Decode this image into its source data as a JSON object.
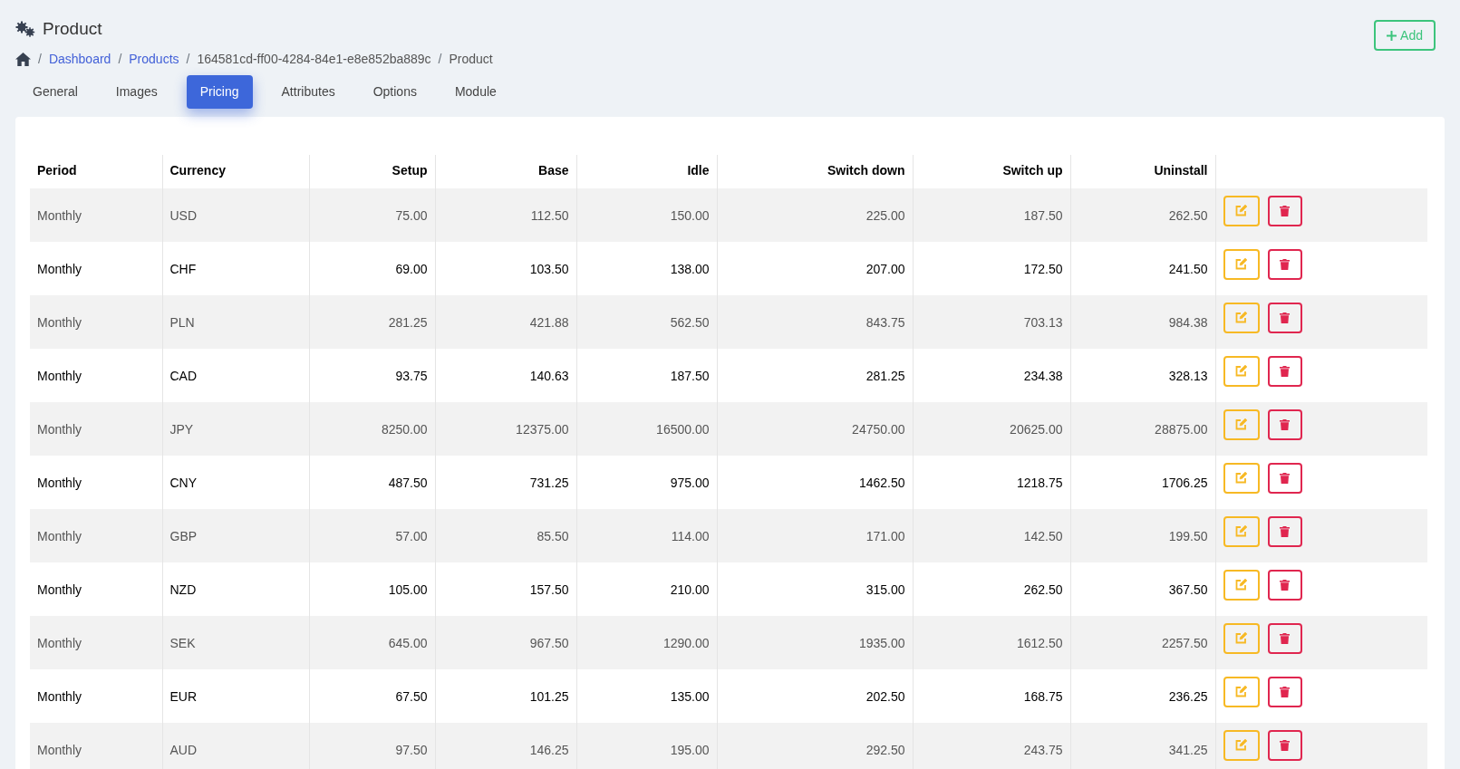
{
  "page": {
    "title": "Product"
  },
  "breadcrumb": [
    {
      "separator": "/",
      "label": "Dashboard",
      "link": true
    },
    {
      "separator": "/",
      "label": "Products",
      "link": true
    },
    {
      "separator": "/",
      "label": "164581cd-ff00-4284-84e1-e8e852ba889c",
      "link": false
    },
    {
      "separator": "/",
      "label": "Product",
      "link": false
    }
  ],
  "add_button": {
    "label": "Add"
  },
  "tabs": [
    {
      "label": "General",
      "selected": false
    },
    {
      "label": "Images",
      "selected": false
    },
    {
      "label": "Pricing",
      "selected": true
    },
    {
      "label": "Attributes",
      "selected": false
    },
    {
      "label": "Options",
      "selected": false
    },
    {
      "label": "Module",
      "selected": false
    }
  ],
  "table": {
    "columns": [
      "Period",
      "Currency",
      "Setup",
      "Base",
      "Idle",
      "Switch down",
      "Switch up",
      "Uninstall"
    ],
    "rows": [
      [
        "Monthly",
        "USD",
        "75.00",
        "112.50",
        "150.00",
        "225.00",
        "187.50",
        "262.50"
      ],
      [
        "Monthly",
        "CHF",
        "69.00",
        "103.50",
        "138.00",
        "207.00",
        "172.50",
        "241.50"
      ],
      [
        "Monthly",
        "PLN",
        "281.25",
        "421.88",
        "562.50",
        "843.75",
        "703.13",
        "984.38"
      ],
      [
        "Monthly",
        "CAD",
        "93.75",
        "140.63",
        "187.50",
        "281.25",
        "234.38",
        "328.13"
      ],
      [
        "Monthly",
        "JPY",
        "8250.00",
        "12375.00",
        "16500.00",
        "24750.00",
        "20625.00",
        "28875.00"
      ],
      [
        "Monthly",
        "CNY",
        "487.50",
        "731.25",
        "975.00",
        "1462.50",
        "1218.75",
        "1706.25"
      ],
      [
        "Monthly",
        "GBP",
        "57.00",
        "85.50",
        "114.00",
        "171.00",
        "142.50",
        "199.50"
      ],
      [
        "Monthly",
        "NZD",
        "105.00",
        "157.50",
        "210.00",
        "315.00",
        "262.50",
        "367.50"
      ],
      [
        "Monthly",
        "SEK",
        "645.00",
        "967.50",
        "1290.00",
        "1935.00",
        "1612.50",
        "2257.50"
      ],
      [
        "Monthly",
        "EUR",
        "67.50",
        "101.25",
        "135.00",
        "202.50",
        "168.75",
        "236.25"
      ],
      [
        "Monthly",
        "AUD",
        "97.50",
        "146.25",
        "195.00",
        "292.50",
        "243.75",
        "341.25"
      ]
    ]
  }
}
